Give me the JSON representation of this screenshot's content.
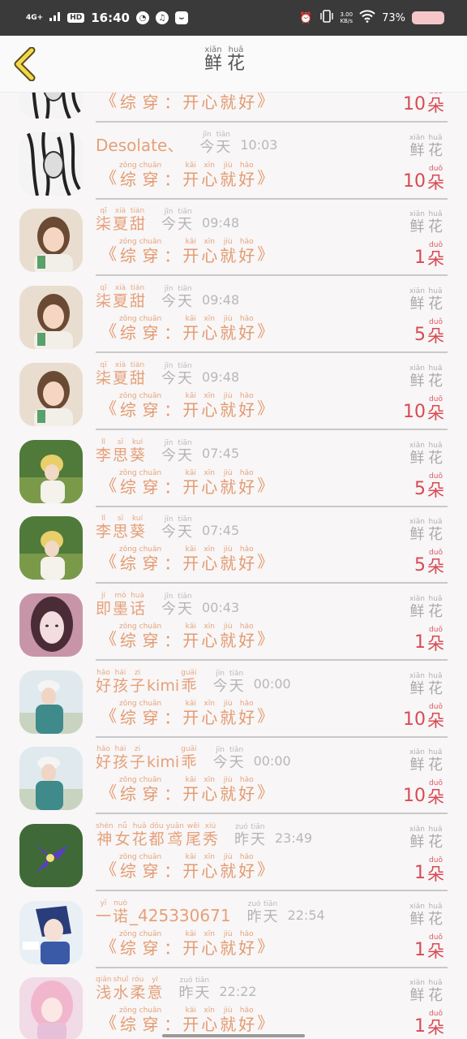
{
  "status": {
    "network": "4G+",
    "hd": "HD",
    "time": "16:40",
    "speed_value": "3.00",
    "speed_unit": "KB/s",
    "battery": "73%"
  },
  "header": {
    "back_icon": "chevron-left-icon",
    "title": [
      {
        "py": "xiān",
        "ch": "鲜"
      },
      {
        "py": "huā",
        "ch": "花"
      }
    ]
  },
  "common": {
    "message_open": "《",
    "message_close": "》",
    "message": [
      {
        "py": "zōng",
        "ch": "综"
      },
      {
        "py": "chuān",
        "ch": "穿"
      },
      {
        "py": "",
        "ch": "："
      },
      {
        "py": "kāi",
        "ch": "开"
      },
      {
        "py": "xīn",
        "ch": "心"
      },
      {
        "py": "jiù",
        "ch": "就"
      },
      {
        "py": "hǎo",
        "ch": "好"
      }
    ],
    "flower_label": [
      {
        "py": "xiān",
        "ch": "鲜"
      },
      {
        "py": "huā",
        "ch": "花"
      }
    ],
    "unit": {
      "py": "duǒ",
      "ch": "朵"
    }
  },
  "rows": [
    {
      "name": [],
      "latin": "",
      "day": [],
      "clock": "",
      "count": "10",
      "avatar": "sketch",
      "partial": true
    },
    {
      "name": [],
      "latin": "Desolate、",
      "day": [
        {
          "py": "jīn",
          "ch": "今"
        },
        {
          "py": "tiān",
          "ch": "天"
        }
      ],
      "clock": "10:03",
      "count": "10",
      "avatar": "sketch"
    },
    {
      "name": [
        {
          "py": "qī",
          "ch": "柒"
        },
        {
          "py": "xià",
          "ch": "夏"
        },
        {
          "py": "tián",
          "ch": "甜"
        }
      ],
      "latin": "",
      "day": [
        {
          "py": "jīn",
          "ch": "今"
        },
        {
          "py": "tiān",
          "ch": "天"
        }
      ],
      "clock": "09:48",
      "count": "1",
      "avatar": "girl"
    },
    {
      "name": [
        {
          "py": "qī",
          "ch": "柒"
        },
        {
          "py": "xià",
          "ch": "夏"
        },
        {
          "py": "tián",
          "ch": "甜"
        }
      ],
      "latin": "",
      "day": [
        {
          "py": "jīn",
          "ch": "今"
        },
        {
          "py": "tiān",
          "ch": "天"
        }
      ],
      "clock": "09:48",
      "count": "5",
      "avatar": "girl"
    },
    {
      "name": [
        {
          "py": "qī",
          "ch": "柒"
        },
        {
          "py": "xià",
          "ch": "夏"
        },
        {
          "py": "tián",
          "ch": "甜"
        }
      ],
      "latin": "",
      "day": [
        {
          "py": "jīn",
          "ch": "今"
        },
        {
          "py": "tiān",
          "ch": "天"
        }
      ],
      "clock": "09:48",
      "count": "10",
      "avatar": "girl"
    },
    {
      "name": [
        {
          "py": "lǐ",
          "ch": "李"
        },
        {
          "py": "sī",
          "ch": "思"
        },
        {
          "py": "kuí",
          "ch": "葵"
        }
      ],
      "latin": "",
      "day": [
        {
          "py": "jīn",
          "ch": "今"
        },
        {
          "py": "tiān",
          "ch": "天"
        }
      ],
      "clock": "07:45",
      "count": "5",
      "avatar": "field"
    },
    {
      "name": [
        {
          "py": "lǐ",
          "ch": "李"
        },
        {
          "py": "sī",
          "ch": "思"
        },
        {
          "py": "kuí",
          "ch": "葵"
        }
      ],
      "latin": "",
      "day": [
        {
          "py": "jīn",
          "ch": "今"
        },
        {
          "py": "tiān",
          "ch": "天"
        }
      ],
      "clock": "07:45",
      "count": "5",
      "avatar": "field"
    },
    {
      "name": [
        {
          "py": "jí",
          "ch": "即"
        },
        {
          "py": "mò",
          "ch": "墨"
        },
        {
          "py": "huà",
          "ch": "话"
        }
      ],
      "latin": "",
      "day": [
        {
          "py": "jīn",
          "ch": "今"
        },
        {
          "py": "tiān",
          "ch": "天"
        }
      ],
      "clock": "00:43",
      "count": "1",
      "avatar": "pink"
    },
    {
      "name": [
        {
          "py": "hǎo",
          "ch": "好"
        },
        {
          "py": "hái",
          "ch": "孩"
        },
        {
          "py": "zi",
          "ch": "子"
        },
        {
          "py": "",
          "ch": "kimi"
        },
        {
          "py": "guāi",
          "ch": "乖"
        }
      ],
      "latin": "",
      "day": [
        {
          "py": "jīn",
          "ch": "今"
        },
        {
          "py": "tiān",
          "ch": "天"
        }
      ],
      "clock": "00:00",
      "count": "10",
      "avatar": "sky"
    },
    {
      "name": [
        {
          "py": "hǎo",
          "ch": "好"
        },
        {
          "py": "hái",
          "ch": "孩"
        },
        {
          "py": "zi",
          "ch": "子"
        },
        {
          "py": "",
          "ch": "kimi"
        },
        {
          "py": "guāi",
          "ch": "乖"
        }
      ],
      "latin": "",
      "day": [
        {
          "py": "jīn",
          "ch": "今"
        },
        {
          "py": "tiān",
          "ch": "天"
        }
      ],
      "clock": "00:00",
      "count": "10",
      "avatar": "sky"
    },
    {
      "name": [
        {
          "py": "shén",
          "ch": "神"
        },
        {
          "py": "nǚ",
          "ch": "女"
        },
        {
          "py": "huā",
          "ch": "花"
        },
        {
          "py": "dōu",
          "ch": "都"
        },
        {
          "py": "yuān",
          "ch": "鸢"
        },
        {
          "py": "wěi",
          "ch": "尾"
        },
        {
          "py": "xiù",
          "ch": "秀"
        }
      ],
      "latin": "",
      "day": [
        {
          "py": "zuó",
          "ch": "昨"
        },
        {
          "py": "tiān",
          "ch": "天"
        }
      ],
      "clock": "23:49",
      "count": "1",
      "avatar": "iris"
    },
    {
      "name": [
        {
          "py": "yī",
          "ch": "一"
        },
        {
          "py": "nuò",
          "ch": "诺"
        }
      ],
      "latin": "_425330671",
      "day": [
        {
          "py": "zuó",
          "ch": "昨"
        },
        {
          "py": "tiān",
          "ch": "天"
        }
      ],
      "clock": "22:54",
      "count": "1",
      "avatar": "anime"
    },
    {
      "name": [
        {
          "py": "qiǎn",
          "ch": "浅"
        },
        {
          "py": "shuǐ",
          "ch": "水"
        },
        {
          "py": "róu",
          "ch": "柔"
        },
        {
          "py": "yì",
          "ch": "意"
        }
      ],
      "latin": "",
      "day": [
        {
          "py": "zuó",
          "ch": "昨"
        },
        {
          "py": "tiān",
          "ch": "天"
        }
      ],
      "clock": "22:22",
      "count": "1",
      "avatar": "pinkanime"
    }
  ]
}
